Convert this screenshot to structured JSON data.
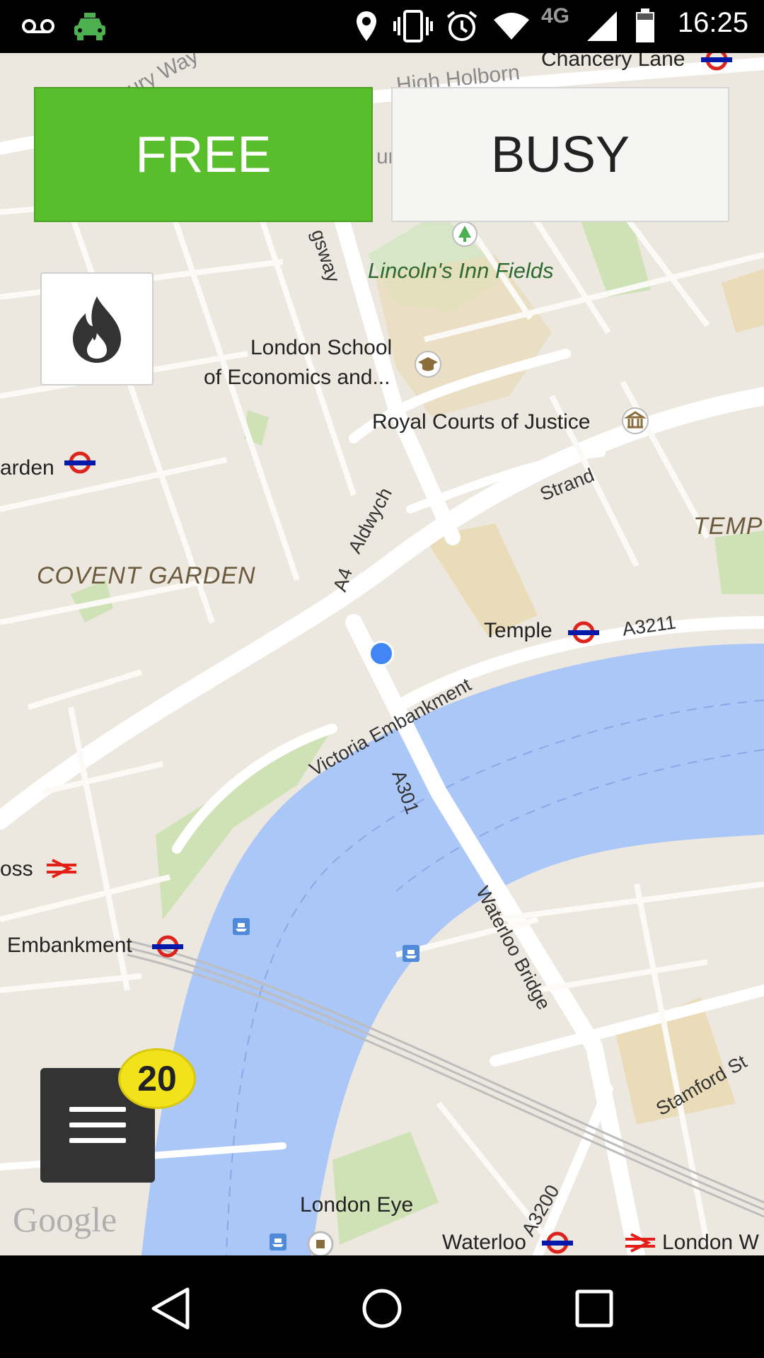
{
  "status_bar": {
    "time": "16:25",
    "network": "4G",
    "icons": [
      "voicemail-icon",
      "taxi-icon",
      "location-icon",
      "vibrate-icon",
      "alarm-icon",
      "wifi-icon",
      "signal-icon",
      "battery-icon"
    ]
  },
  "controls": {
    "free_label": "FREE",
    "busy_label": "BUSY",
    "menu_badge": "20",
    "free_color": "#59be2c"
  },
  "map": {
    "attribution": "Google",
    "labels": {
      "chancery_lane": "Chancery Lane",
      "high_holborn": "High Holborn",
      "bury_way": "bury Way",
      "kingsway": "gsway",
      "lincolns_inn": "Lincoln's Inn Fields",
      "lse_line1": "London School",
      "lse_line2": "of Economics and...",
      "royal_courts": "Royal Courts of Justice",
      "garden": "arden",
      "aldwych": "Aldwych",
      "a4": "A4",
      "strand": "Strand",
      "temple_area": "TEMPI",
      "covent_garden": "COVENT GARDEN",
      "temple": "Temple",
      "a3211": "A3211",
      "victoria_embankment": "Victoria Embankment",
      "a301": "A301",
      "cross": "oss",
      "embankment": "Embankment",
      "waterloo_bridge": "Waterloo Bridge",
      "stamford_st": "Stamford St",
      "a3200": "A3200",
      "london_eye": "London Eye",
      "waterloo": "Waterloo",
      "london_w": "London W",
      "mus": "um"
    }
  }
}
